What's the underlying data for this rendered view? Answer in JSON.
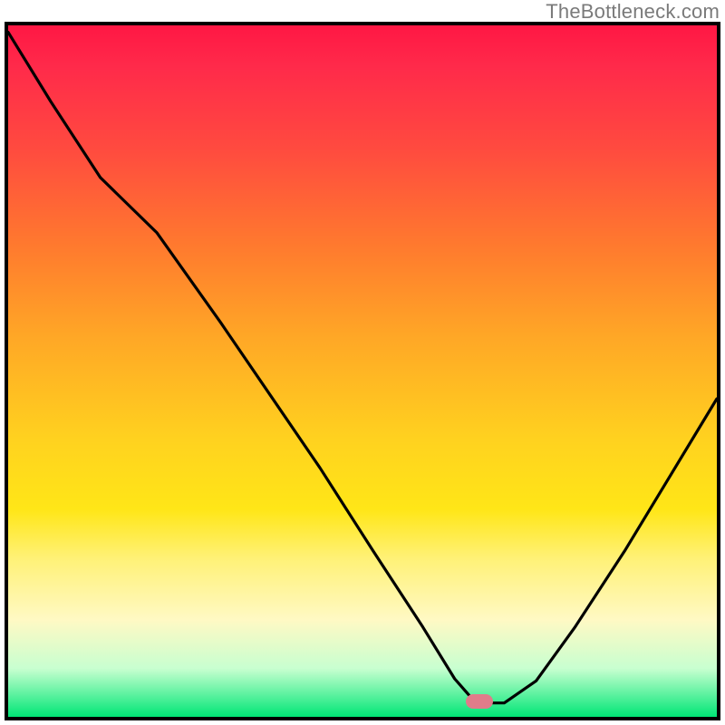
{
  "watermark": {
    "text": "TheBottleneck.com"
  },
  "colors": {
    "frame": "#000000",
    "curve": "#000000",
    "marker": "#e07c8a",
    "gradient_stops": [
      "#ff1744",
      "#ff2a4a",
      "#ff4b3f",
      "#ff7a2e",
      "#ffa726",
      "#ffd21f",
      "#ffe617",
      "#fff176",
      "#fff9c4",
      "#c8ffd0",
      "#00e676"
    ]
  },
  "marker": {
    "x_fraction": 0.665,
    "y_fraction": 0.978
  },
  "chart_data": {
    "type": "line",
    "title": "",
    "xlabel": "",
    "ylabel": "",
    "xlim": [
      0,
      1
    ],
    "ylim": [
      0,
      1
    ],
    "note": "x,y in axis-fraction units; y is distance below top (0=top, 1=bottom). Curve read from pixels.",
    "minimum_x": 0.665,
    "series": [
      {
        "name": "bottleneck-curve",
        "x": [
          0.0,
          0.06,
          0.13,
          0.21,
          0.3,
          0.38,
          0.44,
          0.515,
          0.585,
          0.63,
          0.66,
          0.7,
          0.745,
          0.8,
          0.87,
          0.935,
          1.0
        ],
        "y": [
          0.01,
          0.11,
          0.22,
          0.3,
          0.43,
          0.55,
          0.64,
          0.76,
          0.87,
          0.945,
          0.98,
          0.98,
          0.948,
          0.87,
          0.76,
          0.65,
          0.54
        ]
      }
    ]
  }
}
